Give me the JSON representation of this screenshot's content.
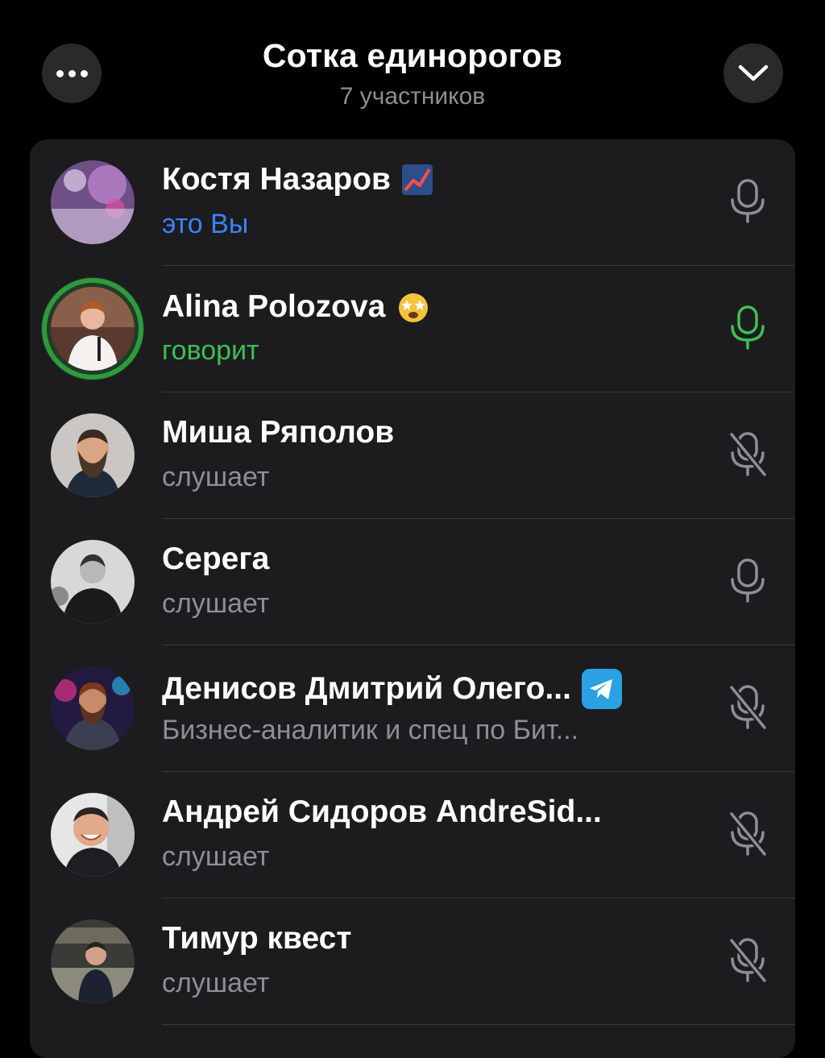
{
  "header": {
    "title": "Сотка единорогов",
    "subtitle": "7 участников",
    "more_icon": "more-dots-icon",
    "collapse_icon": "chevron-down-icon"
  },
  "colors": {
    "background": "#000000",
    "panel": "#1c1c1e",
    "you": "#3b82f6",
    "speaking": "#3fbf53",
    "muted_text": "#8e8e93"
  },
  "participants": [
    {
      "name": "Костя Назаров",
      "status": "это Вы",
      "status_type": "you",
      "badge": "chart-increasing-emoji",
      "mic": "mic-icon"
    },
    {
      "name": "Alina Polozova",
      "status": "говорит",
      "status_type": "speaking",
      "badge": "star-struck-emoji",
      "mic": "mic-active-icon"
    },
    {
      "name": "Миша Ряполов",
      "status": "слушает",
      "status_type": "listening",
      "badge": "",
      "mic": "mic-muted-icon"
    },
    {
      "name": "Серега",
      "status": "слушает",
      "status_type": "listening",
      "badge": "",
      "mic": "mic-icon"
    },
    {
      "name": "Денисов Дмитрий Олего...",
      "status": "Бизнес-аналитик и спец по Бит...",
      "status_type": "listening",
      "badge": "telegram-icon",
      "mic": "mic-muted-icon"
    },
    {
      "name": "Андрей Сидоров AndreSid...",
      "status": "слушает",
      "status_type": "listening",
      "badge": "",
      "mic": "mic-muted-icon"
    },
    {
      "name": "Тимур квест",
      "status": "слушает",
      "status_type": "listening",
      "badge": "",
      "mic": "mic-muted-icon"
    }
  ]
}
